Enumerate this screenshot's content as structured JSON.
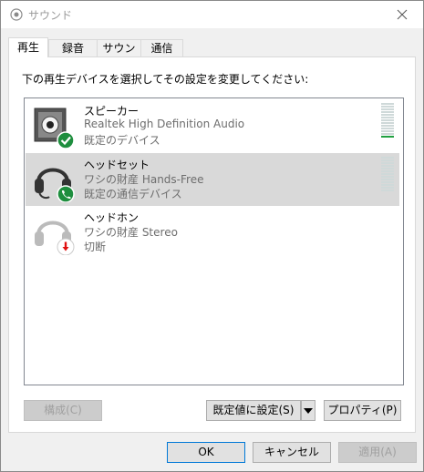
{
  "window": {
    "title": "サウンド"
  },
  "tabs": [
    {
      "label": "再生"
    },
    {
      "label": "録音"
    },
    {
      "label": "サウンド"
    },
    {
      "label": "通信"
    }
  ],
  "instruction": "下の再生デバイスを選択してその設定を変更してください:",
  "devices": [
    {
      "name": "スピーカー",
      "description": "Realtek High Definition Audio",
      "status": "既定のデバイス",
      "icon": "speaker-icon",
      "badge": "check-badge-icon",
      "level": 0.05
    },
    {
      "name": "ヘッドセット",
      "description": "ワシの財産 Hands-Free",
      "status": "既定の通信デバイス",
      "icon": "headset-icon",
      "badge": "phone-badge-icon",
      "level": 0
    },
    {
      "name": "ヘッドホン",
      "description": "ワシの財産 Stereo",
      "status": "切断",
      "icon": "headphones-icon",
      "badge": "disconnected-badge-icon"
    }
  ],
  "buttons": {
    "configure": "構成(C)",
    "set_default": "既定値に設定(S)",
    "properties": "プロパティ(P)",
    "ok": "OK",
    "cancel": "キャンセル",
    "apply": "適用(A)"
  },
  "colors": {
    "accent": "#0078d7",
    "check": "#1e8e3e",
    "disconnected": "#e01010",
    "level": "#20a040"
  }
}
